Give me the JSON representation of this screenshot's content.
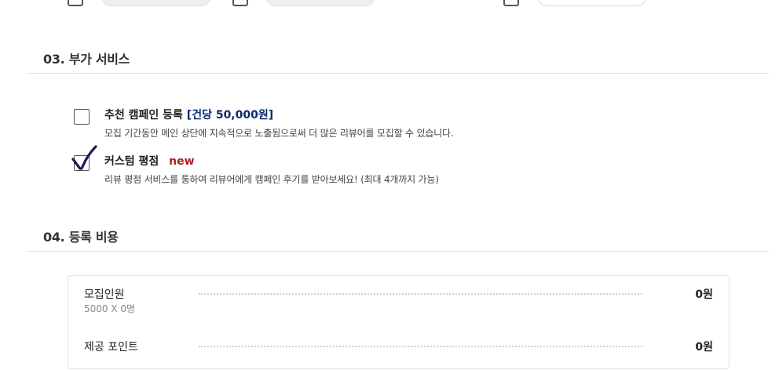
{
  "sections": {
    "addons": {
      "title": "03. 부가 서비스",
      "options": [
        {
          "title": "추천 캠페인 등록",
          "price": "[건당 50,000원]",
          "description": "모집 기간동안 메인 상단에 지속적으로 노출됨으로써 더 많은 리뷰어를 모집할 수 있습니다.",
          "checked": false
        },
        {
          "title": "커스텀 평점",
          "badge": "new",
          "description": "리뷰 평점 서비스를 통하여 리뷰어에게 캠페인 후기를 받아보세요! (최대 4개까지 가능)",
          "checked": true
        }
      ]
    },
    "cost": {
      "title": "04. 등록 비용",
      "rows": [
        {
          "label": "모집인원",
          "sub": "5000 X 0명",
          "value": "0원"
        },
        {
          "label": "제공 포인트",
          "value": "0원"
        }
      ]
    }
  },
  "colors": {
    "accent_navy": "#0a2a6e",
    "badge_red": "#b01c22",
    "check_mark": "#1a1a5e"
  },
  "icons": {
    "unchecked": "checkbox-unchecked-icon",
    "checked": "checkmark-icon"
  }
}
